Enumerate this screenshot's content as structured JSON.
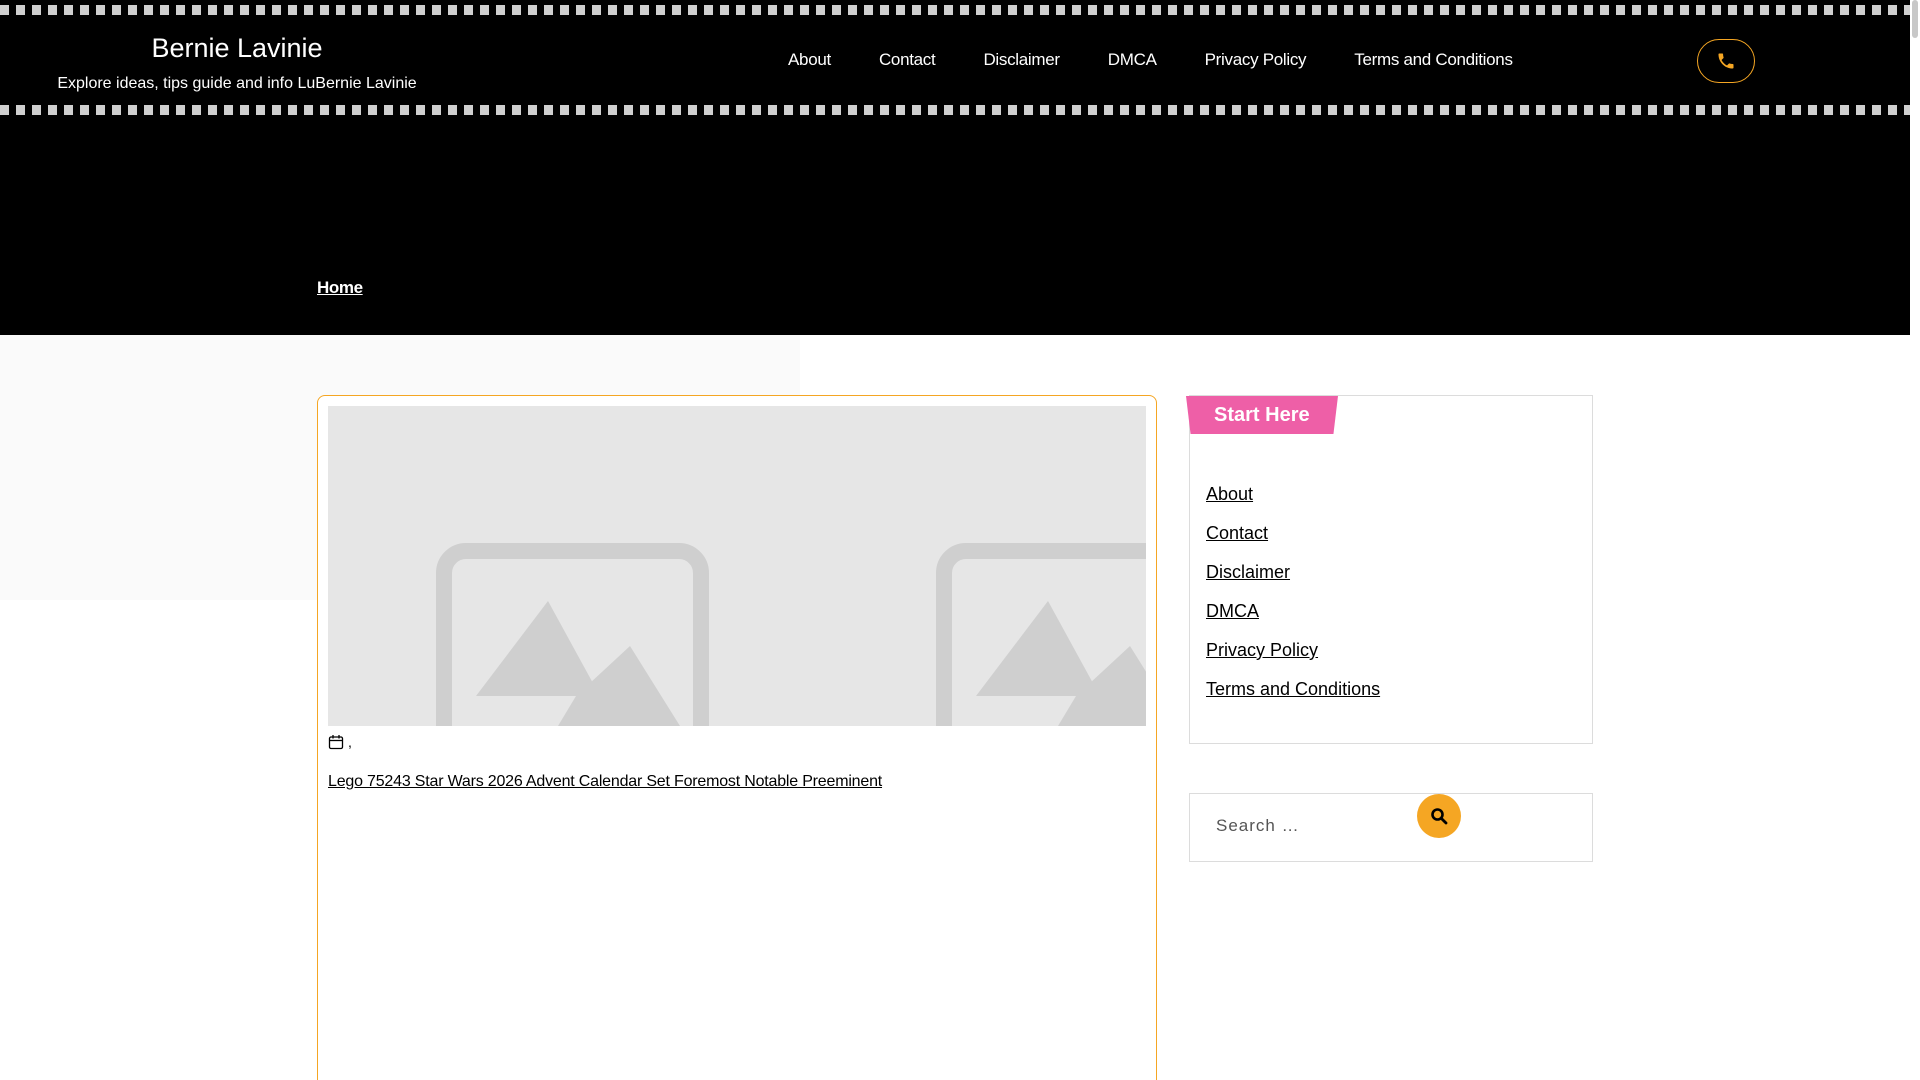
{
  "site": {
    "title": "Bernie Lavinie",
    "tagline": "Explore ideas, tips guide and info LuBernie Lavinie"
  },
  "nav": {
    "items": [
      "About",
      "Contact",
      "Disclaimer",
      "DMCA",
      "Privacy Policy",
      "Terms and Conditions"
    ]
  },
  "header": {
    "phone_icon": "phone-icon",
    "breadcrumb": "Home"
  },
  "post": {
    "meta_separator": ",",
    "calendar_icon": "calendar-icon",
    "title": "Lego 75243 Star Wars 2026 Advent Calendar Set Foremost Notable Preeminent"
  },
  "sidebar": {
    "widget_title": "Start Here",
    "links": [
      "About",
      "Contact",
      "Disclaimer",
      "DMCA",
      "Privacy Policy",
      "Terms and Conditions"
    ],
    "search_placeholder": "Search …",
    "search_icon": "search-icon"
  },
  "colors": {
    "accent": "#f5a623",
    "pink": "#ee5fa7",
    "header_bg": "#000000"
  }
}
